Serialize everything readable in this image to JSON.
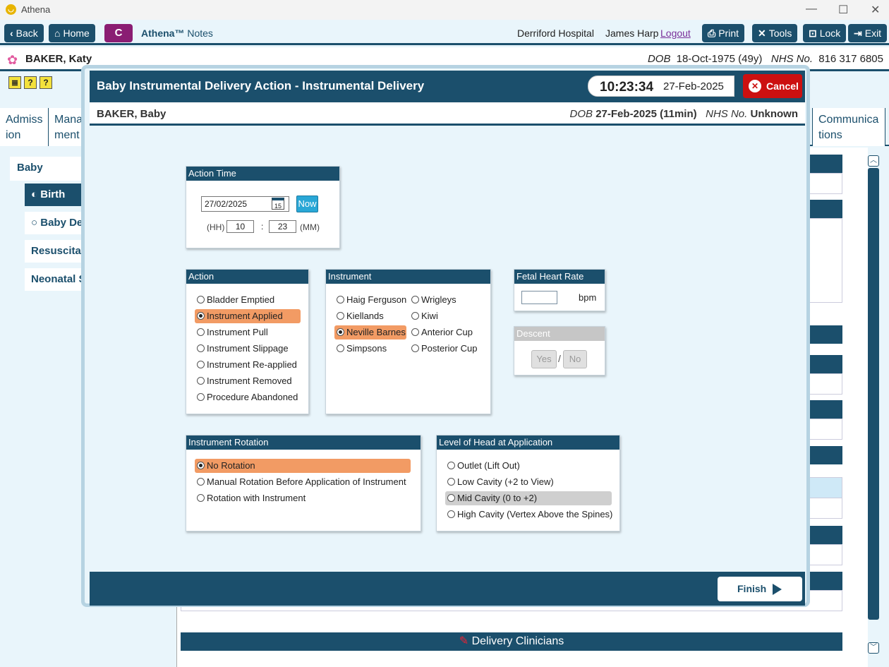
{
  "window": {
    "app_title": "Athena"
  },
  "toolbar": {
    "back": "Back",
    "home": "Home",
    "c": "C",
    "brand": "Athena™",
    "brand_suffix": "Notes",
    "hospital": "Derriford Hospital",
    "user": "James Harp",
    "logout": "Logout",
    "print": "Print",
    "tools": "Tools",
    "lock": "Lock",
    "exit": "Exit"
  },
  "patient": {
    "name": "BAKER, Katy",
    "dob_label": "DOB",
    "dob": "18-Oct-1975 (49y)",
    "nhs_label": "NHS No.",
    "nhs": "816 317 6805"
  },
  "background": {
    "tabs": [
      "Admiss ion",
      "Mana ment",
      "Communica tions"
    ],
    "nav": [
      "Baby",
      "Birth",
      "Baby Det",
      "Resuscitati",
      "Neonatal S"
    ],
    "delivery_clinicians": "Delivery Clinicians"
  },
  "modal": {
    "title": "Baby Instrumental Delivery Action - Instrumental Delivery",
    "clock_time": "10:23:34",
    "clock_date": "27-Feb-2025",
    "cancel": "Cancel",
    "baby_name": "BAKER, Baby",
    "dob_label": "DOB",
    "dob": "27-Feb-2025 (11min)",
    "nhs_label": "NHS No.",
    "nhs": "Unknown",
    "finish": "Finish"
  },
  "action_time": {
    "title": "Action Time",
    "date": "27/02/2025",
    "now": "Now",
    "hh_label": "(HH)",
    "hh": "10",
    "sep": ":",
    "mm": "23",
    "mm_label": "(MM)",
    "cal_day": "15"
  },
  "action": {
    "title": "Action",
    "options": [
      "Bladder Emptied",
      "Instrument Applied",
      "Instrument Pull",
      "Instrument Slippage",
      "Instrument Re-applied",
      "Instrument Removed",
      "Procedure Abandoned"
    ],
    "selected": "Instrument Applied"
  },
  "instrument": {
    "title": "Instrument",
    "col1": [
      "Haig Ferguson",
      "Kiellands",
      "Neville Barnes",
      "Simpsons"
    ],
    "col2": [
      "Wrigleys",
      "Kiwi",
      "Anterior Cup",
      "Posterior Cup"
    ],
    "selected": "Neville Barnes"
  },
  "fhr": {
    "title": "Fetal Heart Rate",
    "value": "",
    "unit": "bpm"
  },
  "descent": {
    "title": "Descent",
    "yes": "Yes",
    "sep": "/",
    "no": "No"
  },
  "rotation": {
    "title": "Instrument Rotation",
    "options": [
      "No Rotation",
      "Manual Rotation Before Application of Instrument",
      "Rotation with Instrument"
    ],
    "selected": "No Rotation"
  },
  "level": {
    "title": "Level of Head at Application",
    "options": [
      "Outlet (Lift Out)",
      "Low Cavity (+2 to View)",
      "Mid Cavity (0 to +2)",
      "High Cavity (Vertex Above the Spines)"
    ],
    "highlighted": "Mid Cavity (0 to +2)"
  },
  "colors": {
    "primary": "#1b4f6c",
    "accent_selected": "#f29b64",
    "cancel": "#cc1010",
    "c_button": "#8a1d73"
  }
}
